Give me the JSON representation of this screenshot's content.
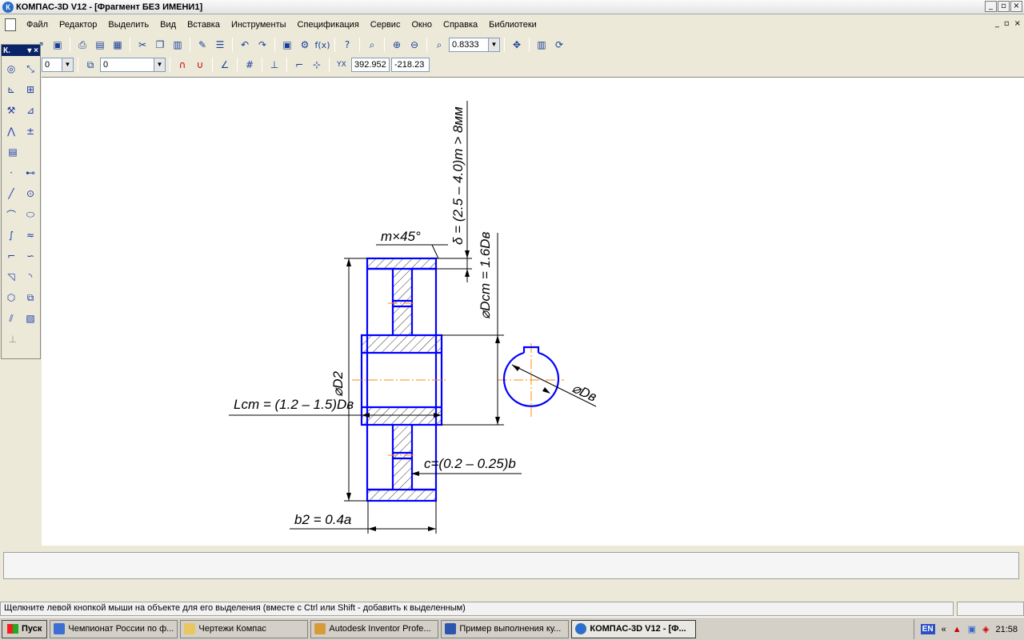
{
  "window": {
    "title": "КОМПАС-3D V12 - [Фрагмент БЕЗ ИМЕНИ1]",
    "app_icon": "К",
    "buttons": [
      "_",
      "▫",
      "×"
    ],
    "mdi_buttons": [
      "_",
      "▫",
      "×"
    ]
  },
  "menu": [
    "Файл",
    "Редактор",
    "Выделить",
    "Вид",
    "Вставка",
    "Инструменты",
    "Спецификация",
    "Сервис",
    "Окно",
    "Справка",
    "Библиотеки"
  ],
  "toolbar_top": {
    "zoom_value": "0.8333",
    "icons": [
      "new-icon",
      "open-icon",
      "save-icon",
      "print-icon",
      "preview-icon",
      "cut-icon",
      "copy-icon",
      "paste-icon",
      "brush-icon",
      "properties-icon",
      "undo-icon",
      "redo-icon",
      "manager-icon",
      "variables-icon",
      "help-icon",
      "zoom-window-icon",
      "zoom-in-icon",
      "zoom-out-icon",
      "zoom-icon",
      "pan-icon",
      "refresh-icon"
    ],
    "fx_label": "f(x)"
  },
  "toolbar_second": {
    "style_value": "0",
    "coord_x": "392.952",
    "coord_y": "-218.23"
  },
  "compact_panel": {
    "title": "К.",
    "icons": [
      "geometry-icon",
      "dimension-icon",
      "symbol-icon",
      "editing-icon",
      "param-icon",
      "measure-icon",
      "select-icon",
      "spec-icon"
    ],
    "tools": [
      "point-icon",
      "auxline-icon",
      "segment-icon",
      "circle-icon",
      "arc-icon",
      "ellipse-icon",
      "spline-icon",
      "bezier-icon",
      "polyline-icon",
      "nurbs-icon",
      "chamfer-icon",
      "fillet-icon",
      "polygon-icon",
      "contour-icon",
      "hatch-icon",
      "fill-icon"
    ]
  },
  "drawing": {
    "labels": {
      "chamfer": "m×45°",
      "delta": "δ = (2.5 – 4.0)m > 8мм",
      "hub_diameter": "⌀Dст = 1.6Dв",
      "outer_diameter": "⌀D2",
      "hub_length": "Lст = (1.2 – 1.5)Dв",
      "disk_thickness": "c=(0.2 – 0.25)b",
      "width": "b2 = 0.4a",
      "shaft_diameter": "⌀Dв"
    }
  },
  "status": {
    "message": "Щелкните левой кнопкой мыши на объекте для его выделения (вместе с Ctrl или Shift - добавить к выделенным)"
  },
  "taskbar": {
    "start_label": "Пуск",
    "tasks": [
      "Чемпионат России по ф...",
      "Чертежи Компас",
      "Autodesk Inventor Profe...",
      "Пример выполнения ку...",
      "КОМПАС-3D V12 - [Ф..."
    ],
    "lang": "EN",
    "time": "21:58"
  },
  "colors": {
    "drawing_line": "#0000ff",
    "drawing_black": "#000000",
    "axis_line": "#ff8c00"
  }
}
